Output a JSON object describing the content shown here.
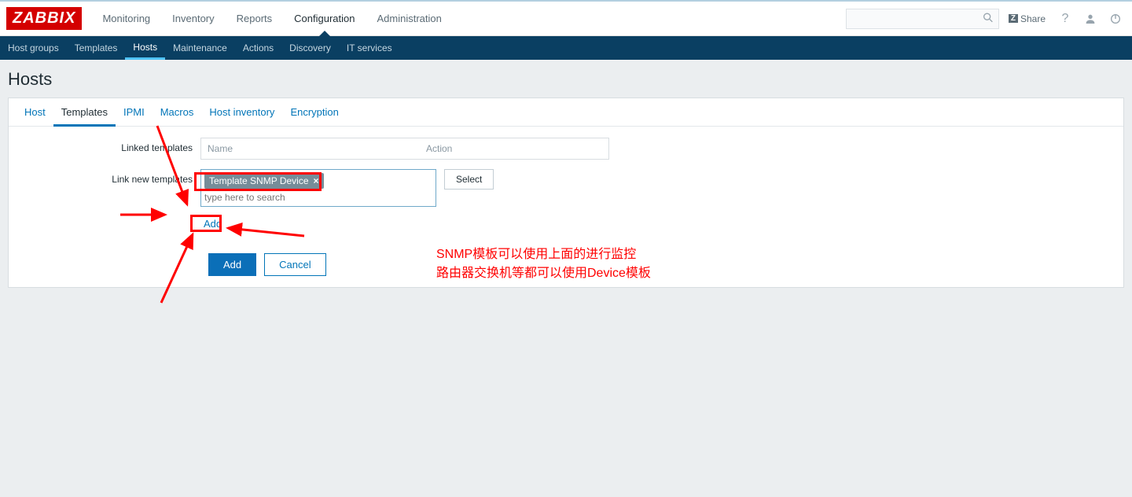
{
  "brand": "ZABBIX",
  "topnav": {
    "items": [
      {
        "label": "Monitoring"
      },
      {
        "label": "Inventory"
      },
      {
        "label": "Reports"
      },
      {
        "label": "Configuration",
        "active": true
      },
      {
        "label": "Administration"
      }
    ],
    "share": "Share",
    "search_placeholder": ""
  },
  "subnav": {
    "items": [
      {
        "label": "Host groups"
      },
      {
        "label": "Templates"
      },
      {
        "label": "Hosts",
        "active": true
      },
      {
        "label": "Maintenance"
      },
      {
        "label": "Actions"
      },
      {
        "label": "Discovery"
      },
      {
        "label": "IT services"
      }
    ]
  },
  "page_title": "Hosts",
  "formtabs": {
    "items": [
      {
        "label": "Host"
      },
      {
        "label": "Templates",
        "active": true
      },
      {
        "label": "IPMI"
      },
      {
        "label": "Macros"
      },
      {
        "label": "Host inventory"
      },
      {
        "label": "Encryption"
      }
    ]
  },
  "form": {
    "linked_templates_label": "Linked templates",
    "table_name_header": "Name",
    "table_action_header": "Action",
    "link_new_templates_label": "Link new templates",
    "chip_label": "Template SNMP Device",
    "ms_placeholder": "type here to search",
    "select_btn": "Select",
    "add_link": "Add",
    "add_btn": "Add",
    "cancel_btn": "Cancel"
  },
  "annotations": {
    "line1": "SNMP模板可以使用上面的进行监控",
    "line2": "路由器交换机等都可以使用Device模板"
  }
}
